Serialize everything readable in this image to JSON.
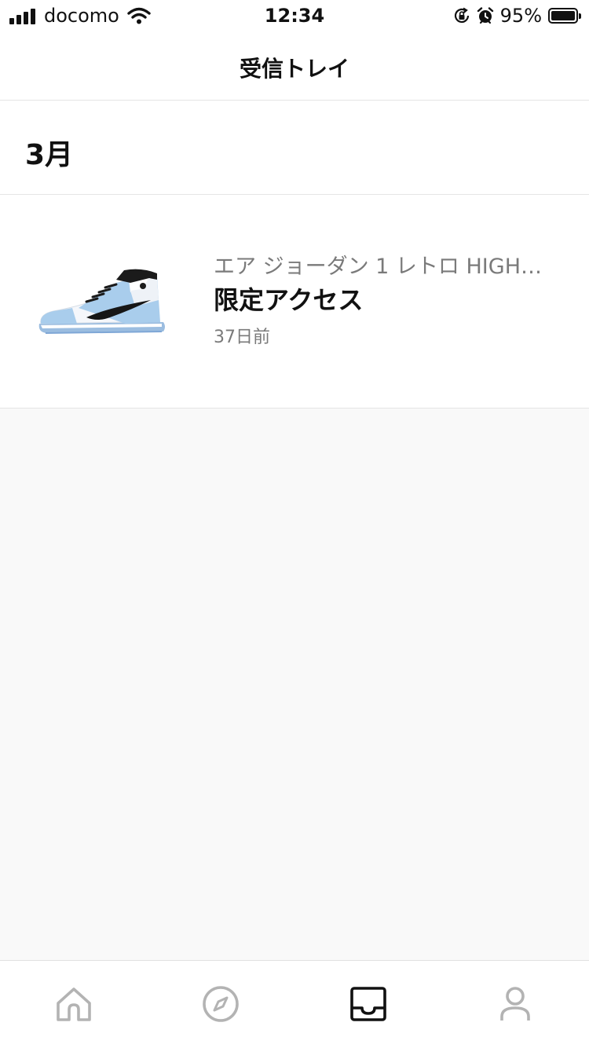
{
  "status_bar": {
    "carrier": "docomo",
    "time": "12:34",
    "battery": "95%",
    "battery_level": 0.95,
    "icons": [
      "signal-icon",
      "wifi-icon",
      "orientation-lock-icon",
      "alarm-icon",
      "battery-icon"
    ]
  },
  "nav": {
    "title": "受信トレイ"
  },
  "section": {
    "title": "3月"
  },
  "inbox": {
    "items": [
      {
        "subtitle": "エア ジョーダン 1 レトロ HIGH…",
        "title": "限定アクセス",
        "time": "37日前",
        "thumbnail_icon": "sneaker-thumbnail"
      }
    ]
  },
  "tab_bar": {
    "tabs": [
      {
        "icon": "home-icon",
        "active": false
      },
      {
        "icon": "compass-icon",
        "active": false
      },
      {
        "icon": "inbox-icon",
        "active": true
      },
      {
        "icon": "profile-icon",
        "active": false
      }
    ]
  },
  "colors": {
    "background": "#f9f9f9",
    "surface": "#ffffff",
    "divider": "#e5e5e5",
    "text_primary": "#111111",
    "text_secondary": "#7a7a7a",
    "tab_inactive": "#b3b3b3",
    "sneaker_blue": "#9fc6e6"
  }
}
